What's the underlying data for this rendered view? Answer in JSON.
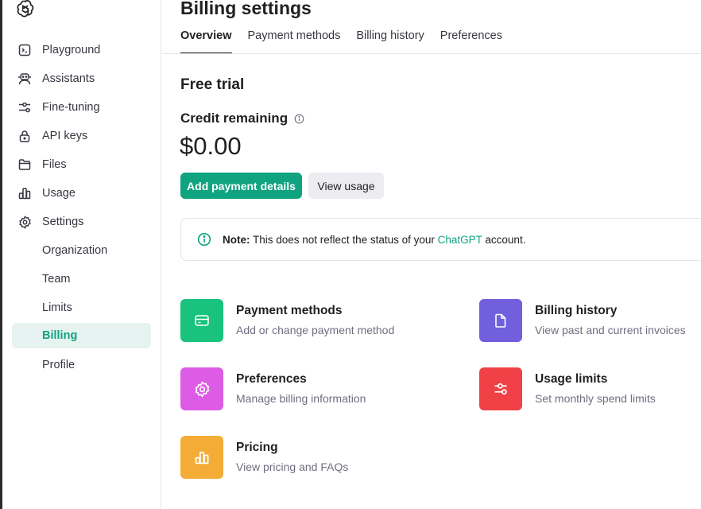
{
  "sidebar": {
    "items": [
      {
        "label": "Playground",
        "icon": "terminal-icon"
      },
      {
        "label": "Assistants",
        "icon": "robot-icon"
      },
      {
        "label": "Fine-tuning",
        "icon": "sliders-icon"
      },
      {
        "label": "API keys",
        "icon": "lock-icon"
      },
      {
        "label": "Files",
        "icon": "folder-icon"
      },
      {
        "label": "Usage",
        "icon": "bar-chart-icon"
      },
      {
        "label": "Settings",
        "icon": "gear-icon"
      }
    ],
    "sub_items": [
      {
        "label": "Organization"
      },
      {
        "label": "Team"
      },
      {
        "label": "Limits"
      },
      {
        "label": "Billing",
        "active": true
      },
      {
        "label": "Profile"
      }
    ]
  },
  "header": {
    "title": "Billing settings",
    "tabs": [
      {
        "label": "Overview",
        "active": true
      },
      {
        "label": "Payment methods"
      },
      {
        "label": "Billing history"
      },
      {
        "label": "Preferences"
      }
    ]
  },
  "main": {
    "plan_title": "Free trial",
    "credit_label": "Credit remaining",
    "credit_amount": "$0.00",
    "add_payment_label": "Add payment details",
    "view_usage_label": "View usage",
    "note": {
      "prefix": "Note:",
      "text_before": " This does not reflect the status of your ",
      "link": "ChatGPT",
      "text_after": " account."
    },
    "cards": [
      {
        "title": "Payment methods",
        "subtitle": "Add or change payment method",
        "icon": "credit-card-icon",
        "color": "#19c37d"
      },
      {
        "title": "Billing history",
        "subtitle": "View past and current invoices",
        "icon": "document-icon",
        "color": "#715fde"
      },
      {
        "title": "Preferences",
        "subtitle": "Manage billing information",
        "icon": "gear-icon",
        "color": "#dd5ce5"
      },
      {
        "title": "Usage limits",
        "subtitle": "Set monthly spend limits",
        "icon": "sliders-icon",
        "color": "#ef4146"
      },
      {
        "title": "Pricing",
        "subtitle": "View pricing and FAQs",
        "icon": "bar-chart-icon",
        "color": "#f4ac36"
      }
    ]
  },
  "colors": {
    "accent": "#10a37f",
    "active_bg": "#e6f3f0"
  }
}
